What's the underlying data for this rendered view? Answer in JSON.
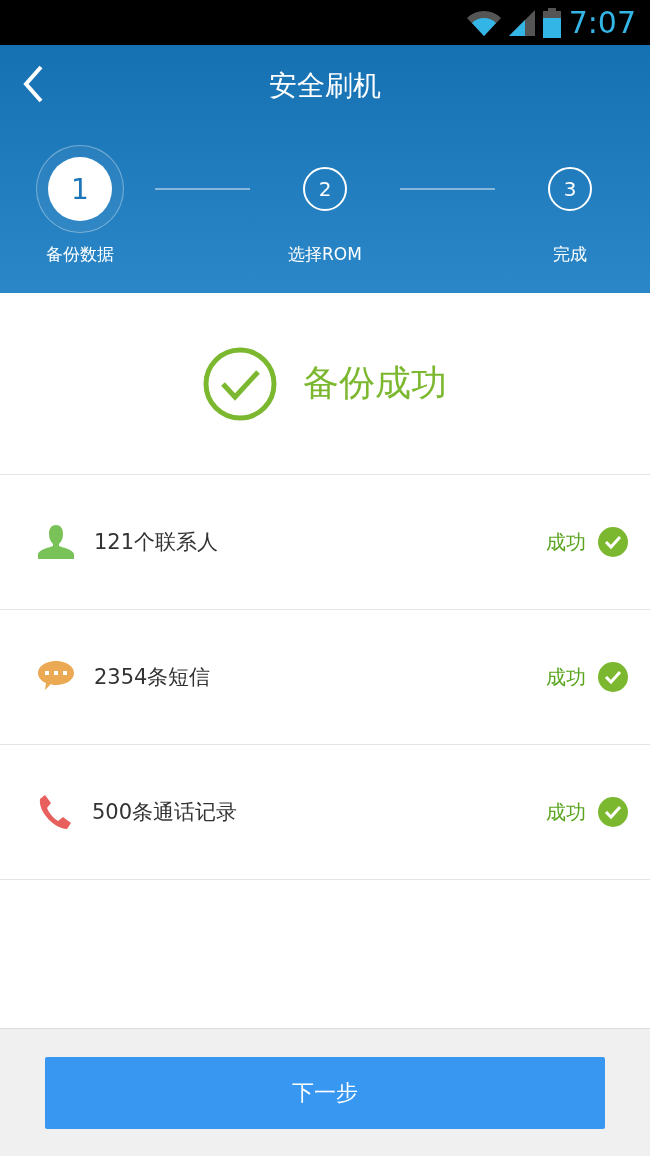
{
  "status_bar": {
    "time": "7:07"
  },
  "header": {
    "title": "安全刷机"
  },
  "steps": [
    {
      "number": "1",
      "label": "备份数据",
      "selected": true
    },
    {
      "number": "2",
      "label": "选择ROM",
      "selected": false
    },
    {
      "number": "3",
      "label": "完成",
      "selected": false
    }
  ],
  "result": {
    "title": "备份成功"
  },
  "items": [
    {
      "kind": "contacts",
      "label": "121个联系人",
      "status": "成功",
      "succeeded": true
    },
    {
      "kind": "messages",
      "label": "2354条短信",
      "status": "成功",
      "succeeded": true
    },
    {
      "kind": "calls",
      "label": "500条通话记录",
      "status": "成功",
      "succeeded": true
    }
  ],
  "next_button": "下一步"
}
